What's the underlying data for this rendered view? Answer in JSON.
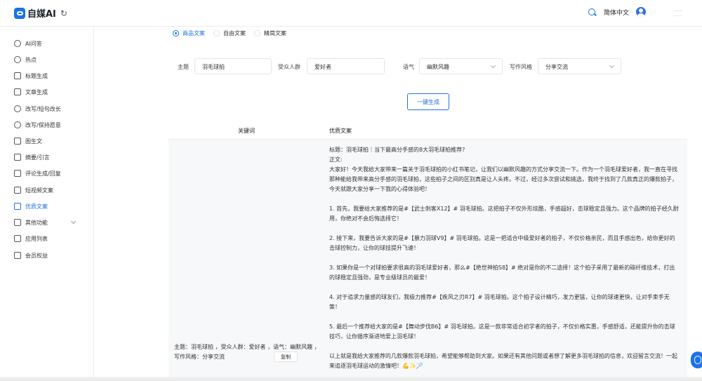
{
  "header": {
    "app_name": "自媒AI",
    "language": "简体中文"
  },
  "sidebar": {
    "items": [
      {
        "label": "AI问答"
      },
      {
        "label": "热点"
      },
      {
        "label": "标题生成"
      },
      {
        "label": "文章生成"
      },
      {
        "label": "改写/短句改长"
      },
      {
        "label": "改写/保持愿意"
      },
      {
        "label": "图生文"
      },
      {
        "label": "摘要/引言"
      },
      {
        "label": "评论生成/回复"
      },
      {
        "label": "短视频文案"
      },
      {
        "label": "优质文案"
      },
      {
        "label": "其他功能"
      },
      {
        "label": "应用列表"
      },
      {
        "label": "会员权益"
      }
    ],
    "active_item": "优质文案"
  },
  "mode_tabs": {
    "options": [
      "商品文案",
      "自由文案",
      "精简文案"
    ],
    "selected": "商品文案"
  },
  "form": {
    "topic_label": "主题",
    "topic_value": "羽毛球拍",
    "audience_label": "受众人群",
    "audience_value": "爱好者",
    "tone_label": "语气",
    "tone_value": "幽默风趣",
    "style_label": "写作风格",
    "style_value": "分享交流",
    "generate_label": "一键生成"
  },
  "table": {
    "col_keywords": "关键词",
    "col_copy": "优质文案",
    "row": {
      "keywords": "主题：羽毛球拍 ，受众人群：爱好者 ，语气：幽默风趣 ，写作风格：分享交流",
      "copy_label": "复制",
      "article": [
        "标题：羽毛球拍｜当下最高分手感的8大羽毛球拍推荐?",
        "正文:",
        "大家好！今天我给大家带来一篇关于羽毛球拍的小红书笔记，让我们以幽默风趣的方式分享交流一下。作为一个羽毛球爱好者，我一直在寻找那种能给我带来高分手感的羽毛球拍，这些拍子之间的区别真是让人头疼。不过，经过多次尝试和挑选，我终于找到了几款真正的爆款拍子，今天就跟大家分享一下我的心得体验吧！",
        "",
        "1. 首先，我要给大家推荐的是#【武士刺客X12】# 羽毛球拍。这把拍子不仅外形炫酷，手感超好，击球稳定且强力。这个品牌的拍子经久耐用，你绝对不会后悔选择它！",
        "",
        "2. 接下来，我要告诉大家的是#【暴力羽球V9】# 羽毛球拍。这是一把适合中级爱好者的拍子，不仅价格亲民，而且手感出色，给你更好的击球控制力，让你的球技提升飞速！",
        "",
        "3. 如果你是一个对球拍要求很高的羽毛球爱好者，那么#【绝世神拍S8】# 绝对是你的不二选择！这个拍子采用了最新的碳纤维技术，打出的球稳定且强劲，是专业级球员的最爱！",
        "",
        "4. 对于追求力量感的球友们，我极力推荐#【疾风之刃R7】# 羽毛球拍。这个拍子设计精巧，发力更猛，让你的球速更快，让对手束手无策！",
        "",
        "5. 最后一个推荐给大家的是#【舞动步伐B6】# 羽毛球拍。这是一款非常适合初学者的拍子，不仅价格实惠，手感舒适，还能提升你的击球技巧，让你循序渐进地爱上羽毛球！",
        "",
        "以上就是我给大家推荐的几款爆款羽毛球拍，希望能够帮助到大家。如果还有其他问题或者想了解更多羽毛球拍的信息，欢迎留言交流！一起来追逐羽毛球运动的激情吧！💪✨🏸"
      ]
    }
  },
  "colors": {
    "accent": "#1a73e8",
    "table_bg": "#f7f8fa"
  }
}
